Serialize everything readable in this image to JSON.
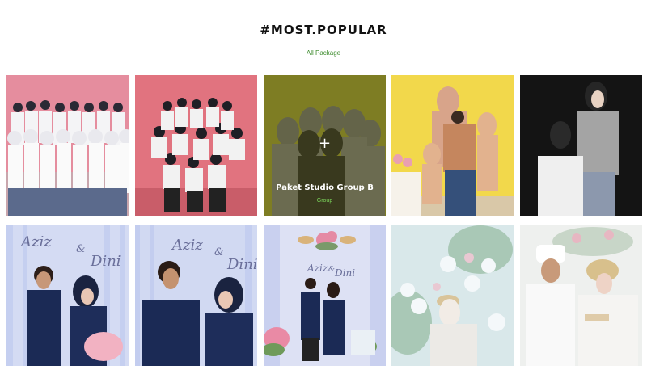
{
  "section": {
    "title": "#MOST.POPULAR",
    "filter_label": "All Package"
  },
  "gallery": {
    "hover_item": {
      "title": "Paket Studio Group B",
      "category": "Group",
      "plus_icon": "+"
    },
    "tiles": [
      {
        "name": "photo-group-school-uniform",
        "bg": "#e88da0"
      },
      {
        "name": "photo-group-pose-pink",
        "bg": "#e27485"
      },
      {
        "name": "photo-group-hijab-olive",
        "bg": "#c6c63a"
      },
      {
        "name": "photo-family-yellow",
        "bg": "#f3d94a"
      },
      {
        "name": "photo-couple-dark",
        "bg": "#151515"
      },
      {
        "name": "photo-couple-blue-1",
        "bg": "#d6ddf4",
        "script_a": "Aziz",
        "script_b": "Dini",
        "amp": "&"
      },
      {
        "name": "photo-couple-blue-2",
        "bg": "#d2daf3",
        "script_a": "Aziz",
        "script_b": "Dini",
        "amp": "&"
      },
      {
        "name": "photo-couple-stage",
        "bg": "#dfe3f5",
        "script_a": "Aziz",
        "script_b": "Dini",
        "amp": "&"
      },
      {
        "name": "photo-bride-flowers",
        "bg": "#d7e7e8"
      },
      {
        "name": "photo-wedding-couple",
        "bg": "#eef1f0"
      }
    ]
  }
}
